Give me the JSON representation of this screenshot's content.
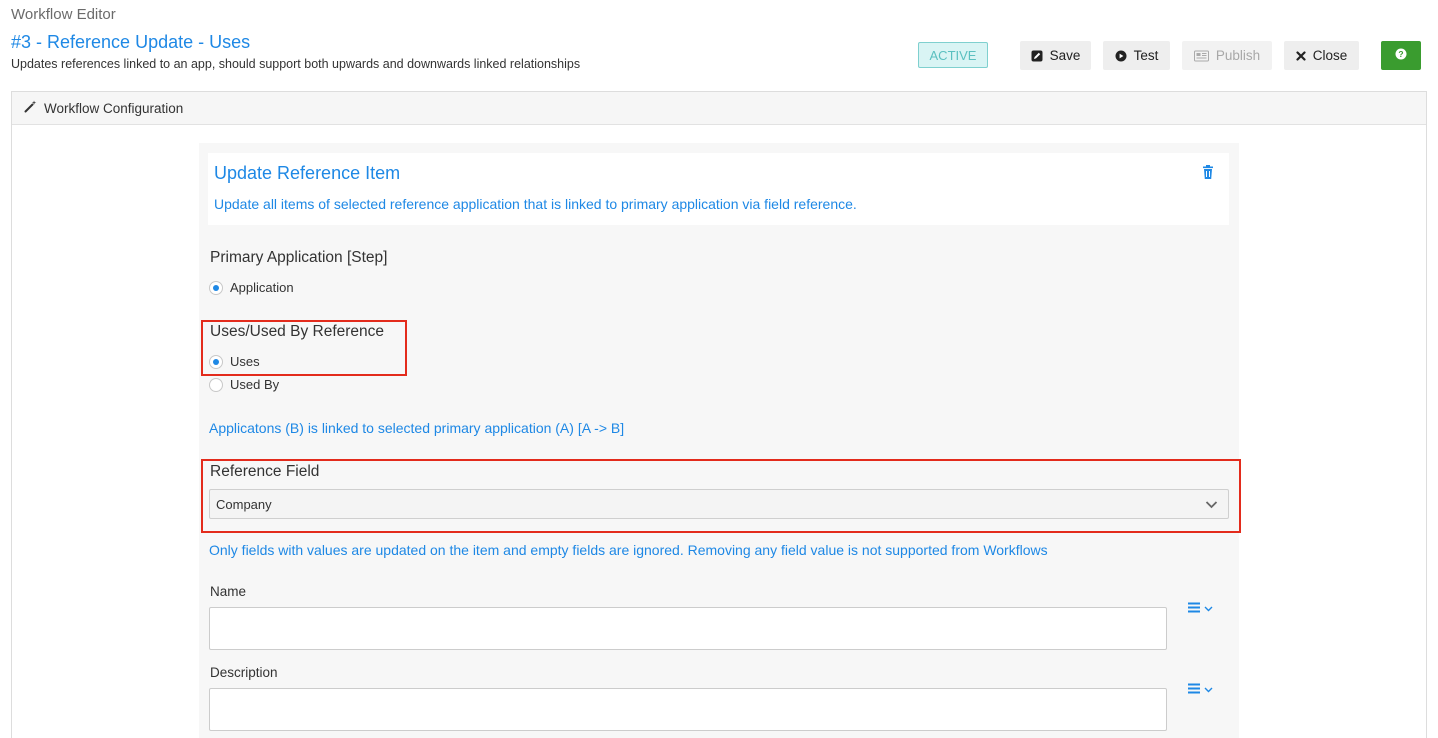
{
  "app": {
    "title": "Workflow Editor"
  },
  "workflow": {
    "title": "#3 - Reference Update - Uses",
    "description": "Updates references linked to an app, should support both upwards and downwards linked relationships",
    "status": "ACTIVE"
  },
  "toolbar": {
    "save_label": "Save",
    "test_label": "Test",
    "publish_label": "Publish",
    "close_label": "Close",
    "help_icon": "question-circle-icon"
  },
  "panel": {
    "title": "Workflow Configuration",
    "icon": "magic-wand-icon"
  },
  "step": {
    "title": "Update Reference Item",
    "subtitle": "Update all items of selected reference application that is linked to primary application via field reference.",
    "delete_icon": "trash-icon"
  },
  "primary_application": {
    "label": "Primary Application [Step]",
    "options": [
      {
        "label": "Application",
        "selected": true
      }
    ]
  },
  "reference_direction": {
    "label": "Uses/Used By Reference",
    "options": [
      {
        "label": "Uses",
        "selected": true
      },
      {
        "label": "Used By",
        "selected": false
      }
    ],
    "info": "Applicatons (B) is linked to selected primary application (A) [A -> B]"
  },
  "reference_field": {
    "label": "Reference Field",
    "selected": "Company"
  },
  "fields_note": "Only fields with values are updated on the item and empty fields are ignored. Removing any field value is not supported from Workflows",
  "fields": [
    {
      "label": "Name",
      "value": ""
    },
    {
      "label": "Description",
      "value": ""
    }
  ],
  "colors": {
    "accent": "#1e88e5",
    "highlight": "#e32b1c",
    "active_badge": "#5bc0c0",
    "help_button": "#3a9c2f"
  }
}
